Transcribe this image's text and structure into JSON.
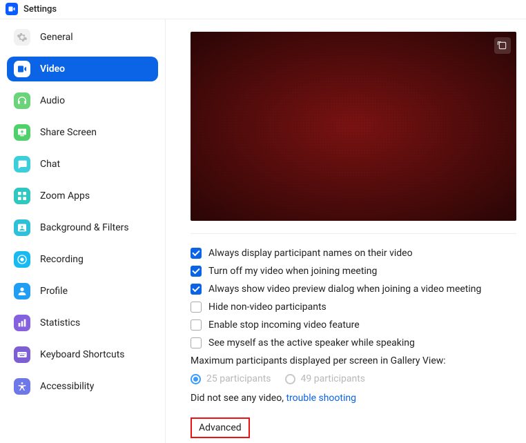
{
  "title": "Settings",
  "sidebar": {
    "items": [
      {
        "label": "General",
        "icon": "gear-icon",
        "bg": "#f1f1f1",
        "fg": "#b9b9b9",
        "active": false
      },
      {
        "label": "Video",
        "icon": "video-icon",
        "bg": "#ffffff",
        "fg": "#0b63e5",
        "active": true
      },
      {
        "label": "Audio",
        "icon": "headphones-icon",
        "bg": "#6bd37a",
        "fg": "#ffffff",
        "active": false
      },
      {
        "label": "Share Screen",
        "icon": "share-screen-icon",
        "bg": "#4fd06b",
        "fg": "#ffffff",
        "active": false
      },
      {
        "label": "Chat",
        "icon": "chat-icon",
        "bg": "#3ccedb",
        "fg": "#ffffff",
        "active": false
      },
      {
        "label": "Zoom Apps",
        "icon": "apps-icon",
        "bg": "#2fc7c0",
        "fg": "#ffffff",
        "active": false
      },
      {
        "label": "Background & Filters",
        "icon": "background-icon",
        "bg": "#2ec0d8",
        "fg": "#ffffff",
        "active": false
      },
      {
        "label": "Recording",
        "icon": "recording-icon",
        "bg": "#18baf2",
        "fg": "#ffffff",
        "active": false
      },
      {
        "label": "Profile",
        "icon": "profile-icon",
        "bg": "#1f9ef3",
        "fg": "#ffffff",
        "active": false
      },
      {
        "label": "Statistics",
        "icon": "statistics-icon",
        "bg": "#8561e0",
        "fg": "#ffffff",
        "active": false
      },
      {
        "label": "Keyboard Shortcuts",
        "icon": "keyboard-icon",
        "bg": "#7d5fd3",
        "fg": "#ffffff",
        "active": false
      },
      {
        "label": "Accessibility",
        "icon": "accessibility-icon",
        "bg": "#6e78e8",
        "fg": "#ffffff",
        "active": false
      }
    ]
  },
  "main": {
    "options": [
      {
        "label": "Always display participant names on their video",
        "checked": true
      },
      {
        "label": "Turn off my video when joining meeting",
        "checked": true
      },
      {
        "label": "Always show video preview dialog when joining a video meeting",
        "checked": true
      },
      {
        "label": "Hide non-video participants",
        "checked": false
      },
      {
        "label": "Enable stop incoming video feature",
        "checked": false
      },
      {
        "label": "See myself as the active speaker while speaking",
        "checked": false
      }
    ],
    "gallery_label": "Maximum participants displayed per screen in Gallery View:",
    "radios": [
      {
        "label": "25 participants",
        "selected": true
      },
      {
        "label": "49 participants",
        "selected": false
      }
    ],
    "trouble_prefix": "Did not see any video, ",
    "trouble_link": "trouble shooting",
    "advanced": "Advanced"
  }
}
